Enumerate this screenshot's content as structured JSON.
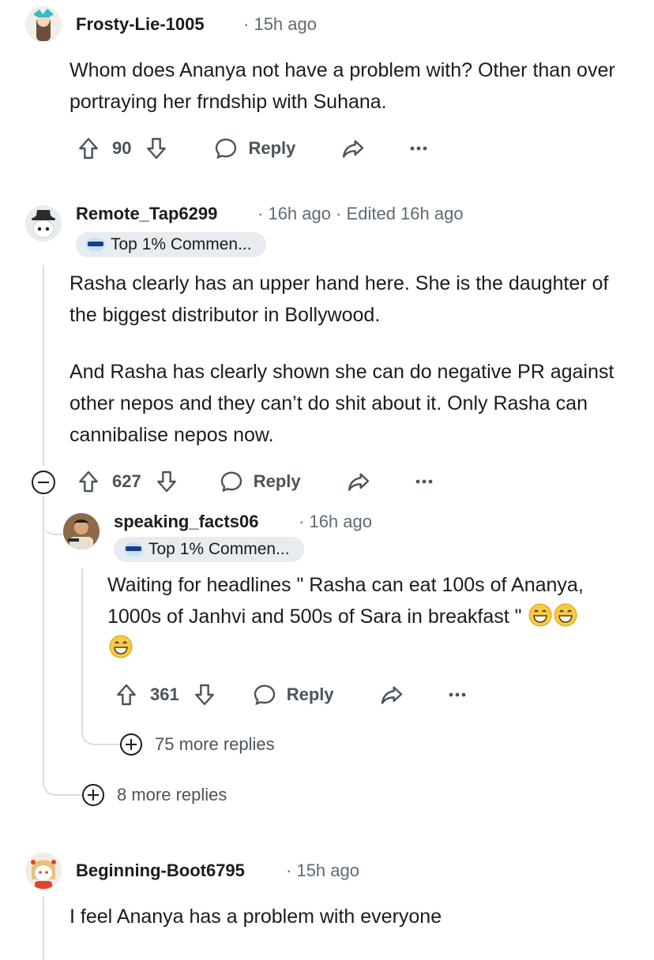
{
  "comments": [
    {
      "username": "Frosty-Lie-1005",
      "time": "15h ago",
      "body": [
        "Whom does Ananya not have a problem with? Other than over portraying her frndship with Suhana."
      ],
      "votes": "90",
      "reply": "Reply"
    },
    {
      "username": "Remote_Tap6299",
      "time": "16h ago",
      "edited": "Edited 16h ago",
      "flair": "Top 1% Commen...",
      "body": [
        "Rasha clearly has an upper hand here. She is the daughter of the biggest distributor in Bollywood.",
        "And Rasha has clearly shown she can do negative PR against other nepos and they can’t do shit about it. Only Rasha can cannibalise nepos now."
      ],
      "votes": "627",
      "reply": "Reply",
      "more_replies": "8 more replies"
    },
    {
      "username": "speaking_facts06",
      "time": "16h ago",
      "flair": "Top 1% Commen...",
      "body": [
        "Waiting for headlines \" Rasha can eat 100s of Ananya, 1000s of Janhvi and 500s of Sara in breakfast \""
      ],
      "votes": "361",
      "reply": "Reply",
      "more_replies": "75 more replies"
    },
    {
      "username": "Beginning-Boot6795",
      "time": "15h ago",
      "body": [
        "I feel Ananya has a problem with everyone"
      ]
    }
  ],
  "icons": {
    "upvote": "upvote-arrow-icon",
    "downvote": "downvote-arrow-icon",
    "reply": "speech-bubble-icon",
    "share": "share-arrow-icon",
    "overflow": "ellipsis-icon",
    "emoji": "grinning-face-emoji"
  },
  "colors": {
    "thread_line": "#d8dde1",
    "meta": "#5f6b73",
    "flair_bg": "#e8ebef"
  }
}
